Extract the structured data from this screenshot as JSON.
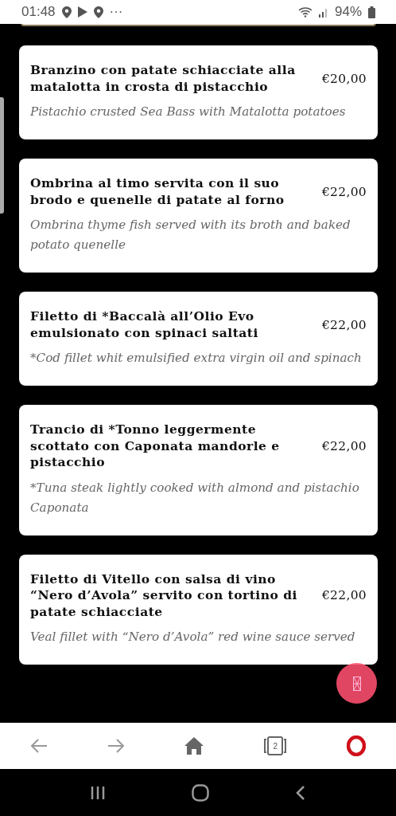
{
  "status_bar": {
    "time": "01:48",
    "more": "···",
    "battery": "94%"
  },
  "dishes": [
    {
      "name": "Branzino con patate schiacciate alla matalotta in crosta di pistacchio",
      "price": "€20,00",
      "description": "Pistachio crusted Sea Bass with Matalotta potatoes"
    },
    {
      "name": "Ombrina al timo servita con il suo brodo e quenelle di patate al forno",
      "price": "€22,00",
      "description": "Ombrina thyme fish served with its broth and baked potato quenelle"
    },
    {
      "name": "Filetto di *Baccalà all’Olio Evo emulsionato con spinaci saltati",
      "price": "€22,00",
      "description": "*Cod fillet whit emulsified extra virgin oil and spinach"
    },
    {
      "name": "Trancio di *Tonno leggermente scottato con Caponata mandorle e pistacchio",
      "price": "€22,00",
      "description": "*Tuna steak lightly cooked with almond and pistachio Caponata"
    },
    {
      "name": "Filetto di Vitello con salsa di vino “Nero d’Avola” servito con tortino di patate schiacciate",
      "price": "€22,00",
      "description": "Veal fillet with “Nero d’Avola” red wine sauce served"
    }
  ],
  "browser_toolbar": {
    "tab_count": "2"
  }
}
